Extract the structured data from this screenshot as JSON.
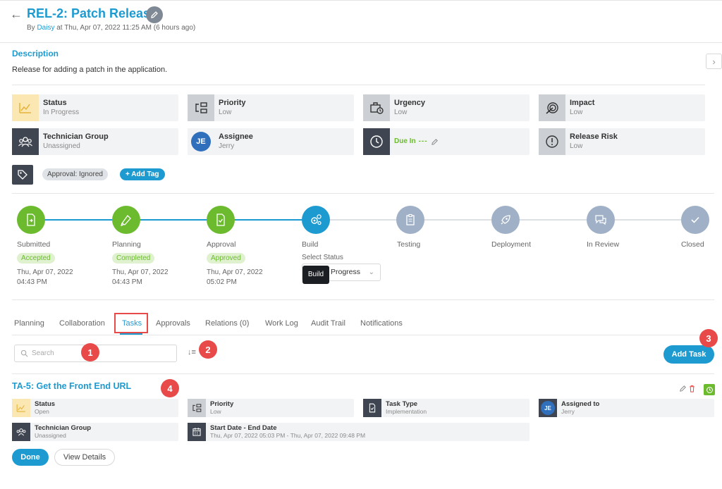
{
  "header": {
    "back_icon": "arrow-left-icon",
    "title": "REL-2: Patch Release",
    "by_prefix": "By",
    "author": "Daisy",
    "meta": "at Thu, Apr 07, 2022 11:25 AM (6 hours ago)"
  },
  "description": {
    "heading": "Description",
    "text": "Release for adding a patch in the application."
  },
  "fields": [
    {
      "label": "Status",
      "value": "In Progress",
      "icon": "trend-icon"
    },
    {
      "label": "Priority",
      "value": "Low",
      "icon": "priority-icon"
    },
    {
      "label": "Urgency",
      "value": "Low",
      "icon": "briefcase-clock-icon"
    },
    {
      "label": "Impact",
      "value": "Low",
      "icon": "impact-icon"
    },
    {
      "label": "Technician Group",
      "value": "Unassigned",
      "icon": "group-icon"
    },
    {
      "label": "Assignee",
      "value": "Jerry",
      "avatar": "JE"
    },
    {
      "label": "Due In",
      "value": "---",
      "icon": "clock-icon"
    },
    {
      "label": "Release Risk",
      "value": "Low",
      "icon": "alert-circle-icon"
    }
  ],
  "tags": {
    "pill": "Approval: Ignored",
    "add": "+ Add Tag"
  },
  "stages": [
    {
      "name": "Submitted",
      "badge": "Accepted",
      "date1": "Thu, Apr 07, 2022",
      "date2": "04:43 PM",
      "state": "done"
    },
    {
      "name": "Planning",
      "badge": "Completed",
      "date1": "Thu, Apr 07, 2022",
      "date2": "04:43 PM",
      "state": "done"
    },
    {
      "name": "Approval",
      "badge": "Approved",
      "date1": "Thu, Apr 07, 2022",
      "date2": "05:02 PM",
      "state": "done"
    },
    {
      "name": "Build",
      "state": "current"
    },
    {
      "name": "Testing",
      "state": "pending"
    },
    {
      "name": "Deployment",
      "state": "pending"
    },
    {
      "name": "In Review",
      "state": "pending"
    },
    {
      "name": "Closed",
      "state": "pending"
    }
  ],
  "build": {
    "select_label": "Select Status",
    "select_value": "Progress",
    "tooltip": "Build"
  },
  "tabs": [
    "Planning",
    "Collaboration",
    "Tasks",
    "Approvals",
    "Relations (0)",
    "Work Log",
    "Audit Trail",
    "Notifications"
  ],
  "active_tab": "Tasks",
  "search": {
    "placeholder": "Search"
  },
  "add_task": "Add Task",
  "callouts": [
    "1",
    "2",
    "3",
    "4"
  ],
  "task": {
    "title": "TA-5: Get the Front End URL",
    "fields": [
      {
        "label": "Status",
        "value": "Open"
      },
      {
        "label": "Priority",
        "value": "Low"
      },
      {
        "label": "Task Type",
        "value": "Implementation"
      },
      {
        "label": "Assigned to",
        "value": "Jerry",
        "avatar": "JE"
      },
      {
        "label": "Technician Group",
        "value": "Unassigned"
      },
      {
        "label": "Start Date - End Date",
        "value": "Thu, Apr 07, 2022 05:03 PM - Thu, Apr 07, 2022 09:48 PM"
      }
    ],
    "done": "Done",
    "view_details": "View Details"
  },
  "colors": {
    "accent": "#1d9bd1",
    "success": "#6cbb2f",
    "callout": "#e84a4a",
    "pending": "#9fb0c7"
  }
}
